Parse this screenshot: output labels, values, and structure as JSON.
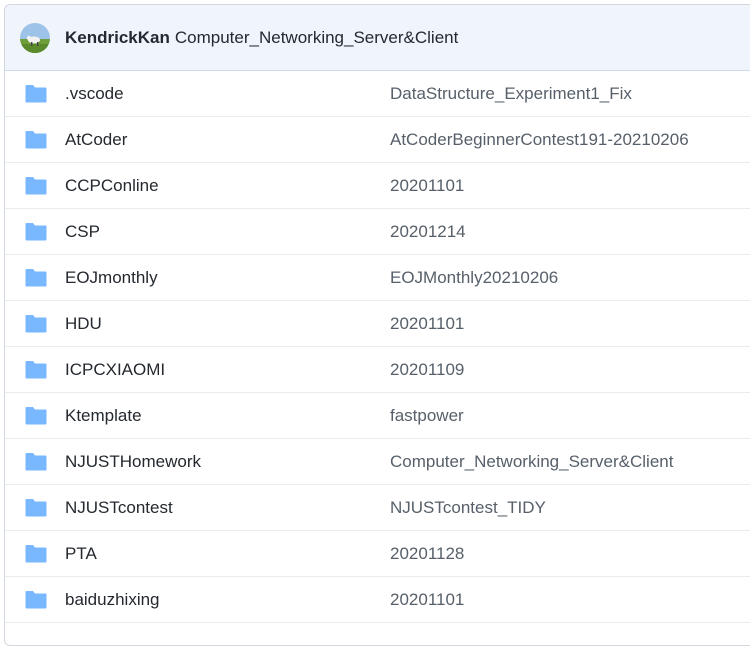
{
  "header": {
    "author": "KendrickKan",
    "message": "Computer_Networking_Server&Client"
  },
  "files": [
    {
      "name": ".vscode",
      "commit": "DataStructure_Experiment1_Fix",
      "icon": "folder-icon"
    },
    {
      "name": "AtCoder",
      "commit": "AtCoderBeginnerContest191-20210206",
      "icon": "folder-icon"
    },
    {
      "name": "CCPConline",
      "commit": "20201101",
      "icon": "folder-icon"
    },
    {
      "name": "CSP",
      "commit": "20201214",
      "icon": "folder-icon"
    },
    {
      "name": "EOJmonthly",
      "commit": "EOJMonthly20210206",
      "icon": "folder-icon"
    },
    {
      "name": "HDU",
      "commit": "20201101",
      "icon": "folder-icon"
    },
    {
      "name": "ICPCXIAOMI",
      "commit": "20201109",
      "icon": "folder-icon"
    },
    {
      "name": "Ktemplate",
      "commit": "fastpower",
      "icon": "folder-icon"
    },
    {
      "name": "NJUSTHomework",
      "commit": "Computer_Networking_Server&Client",
      "icon": "folder-icon"
    },
    {
      "name": "NJUSTcontest",
      "commit": "NJUSTcontest_TIDY",
      "icon": "folder-icon"
    },
    {
      "name": "PTA",
      "commit": "20201128",
      "icon": "folder-icon"
    },
    {
      "name": "baiduzhixing",
      "commit": "20201101",
      "icon": "folder-icon"
    }
  ],
  "colors": {
    "folder": "#79b8ff",
    "header_bg": "#f0f5fc",
    "text": "#24292f",
    "muted": "#57606a"
  }
}
